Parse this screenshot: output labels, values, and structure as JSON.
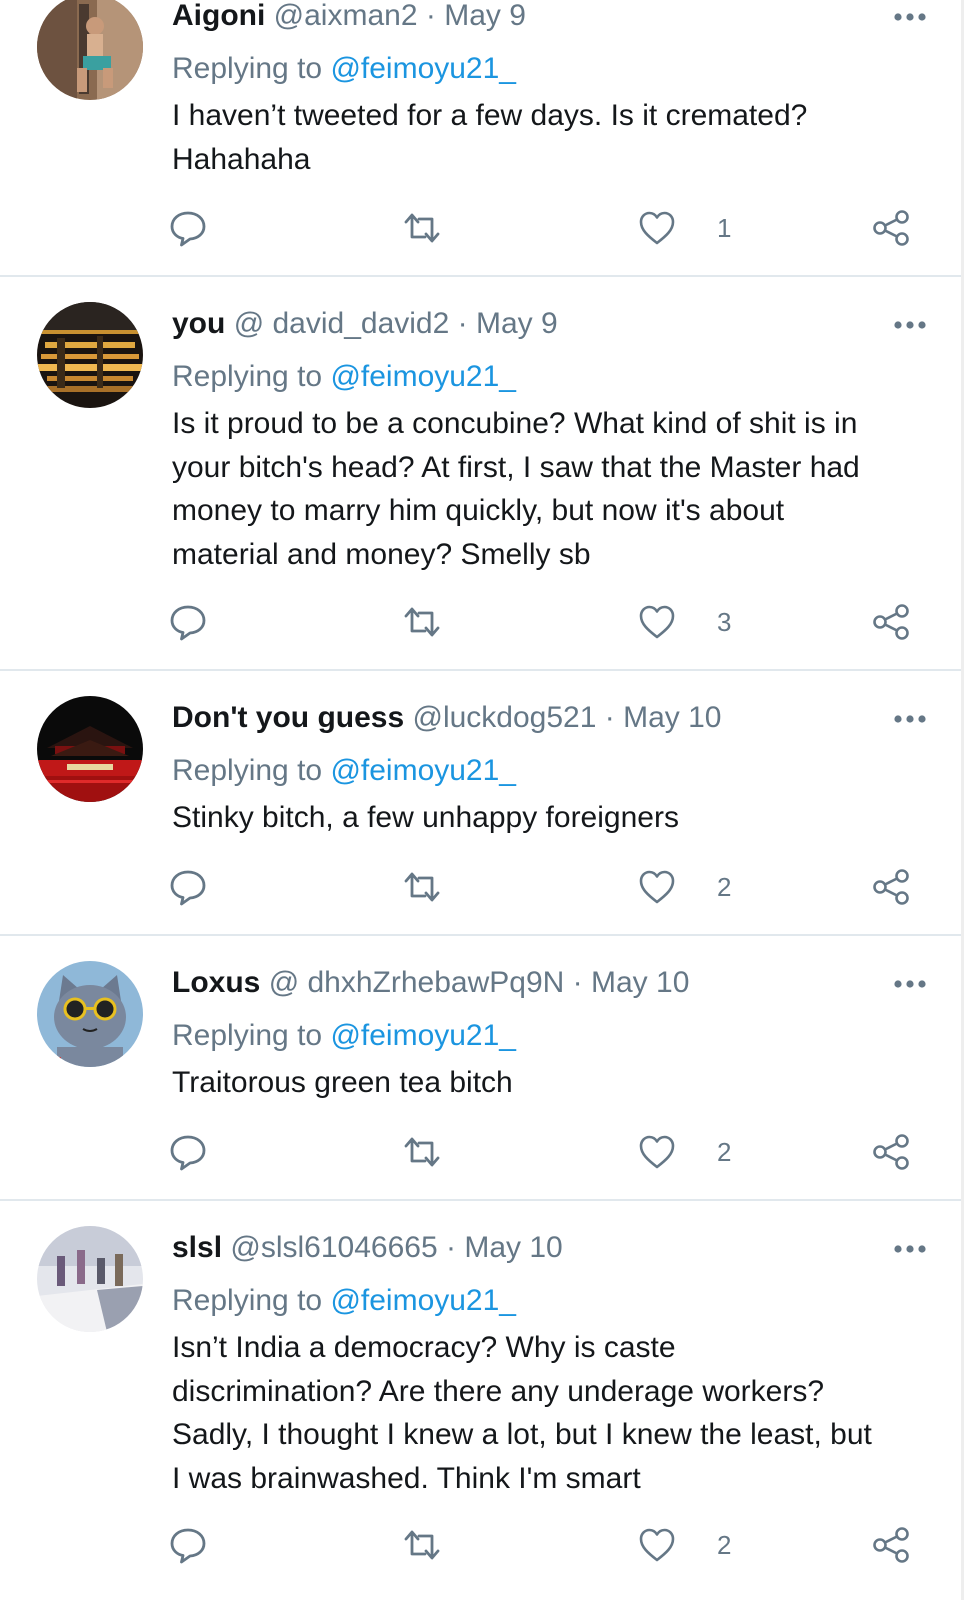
{
  "reply_prefix": "Replying to",
  "tweets": [
    {
      "name": "Aigoni",
      "handle": "@aixman2",
      "date": "May 9",
      "reply_to": "@feimoyu21_",
      "lines": [
        "I haven’t tweeted for a few days. Is it cremated?",
        "Hahahaha"
      ],
      "likes": "1",
      "avatar": "person-sitting-photo-avatar"
    },
    {
      "name": "you",
      "handle": "@ david_david2",
      "date": "May 9",
      "reply_to": "@feimoyu21_",
      "lines": [
        "Is it proud to be a concubine? What kind of shit is in",
        "your bitch's head? At first, I saw that the Master had",
        "money to marry him quickly, but now it's about",
        "material and money? Smelly sb"
      ],
      "likes": "3",
      "avatar": "night-city-lights-avatar"
    },
    {
      "name": "Don't you guess",
      "handle": "@luckdog521",
      "date": "May 10",
      "reply_to": "@feimoyu21_",
      "lines": [
        "Stinky bitch, a few unhappy foreigners"
      ],
      "likes": "2",
      "avatar": "red-gate-building-avatar"
    },
    {
      "name": "Loxus",
      "handle": "@ dhxhZrhebawPq9N",
      "date": "May 10",
      "reply_to": "@feimoyu21_",
      "lines": [
        "Traitorous green tea bitch"
      ],
      "likes": "2",
      "avatar": "cartoon-cat-sunglasses-avatar"
    },
    {
      "name": "slsl",
      "handle": "@slsl61046665",
      "date": "May 10",
      "reply_to": "@feimoyu21_",
      "lines": [
        "Isn’t India a democracy? Why is caste",
        "discrimination? Are there any underage workers?",
        "Sadly, I thought I knew a lot, but I knew the least, but",
        "I was brainwashed. Think I'm smart"
      ],
      "likes": "2",
      "avatar": "painting-figures-avatar"
    }
  ],
  "colors": {
    "text": "#14171a",
    "secondary": "#657786",
    "link": "#1b95e0",
    "divider": "#e1e8ed"
  }
}
